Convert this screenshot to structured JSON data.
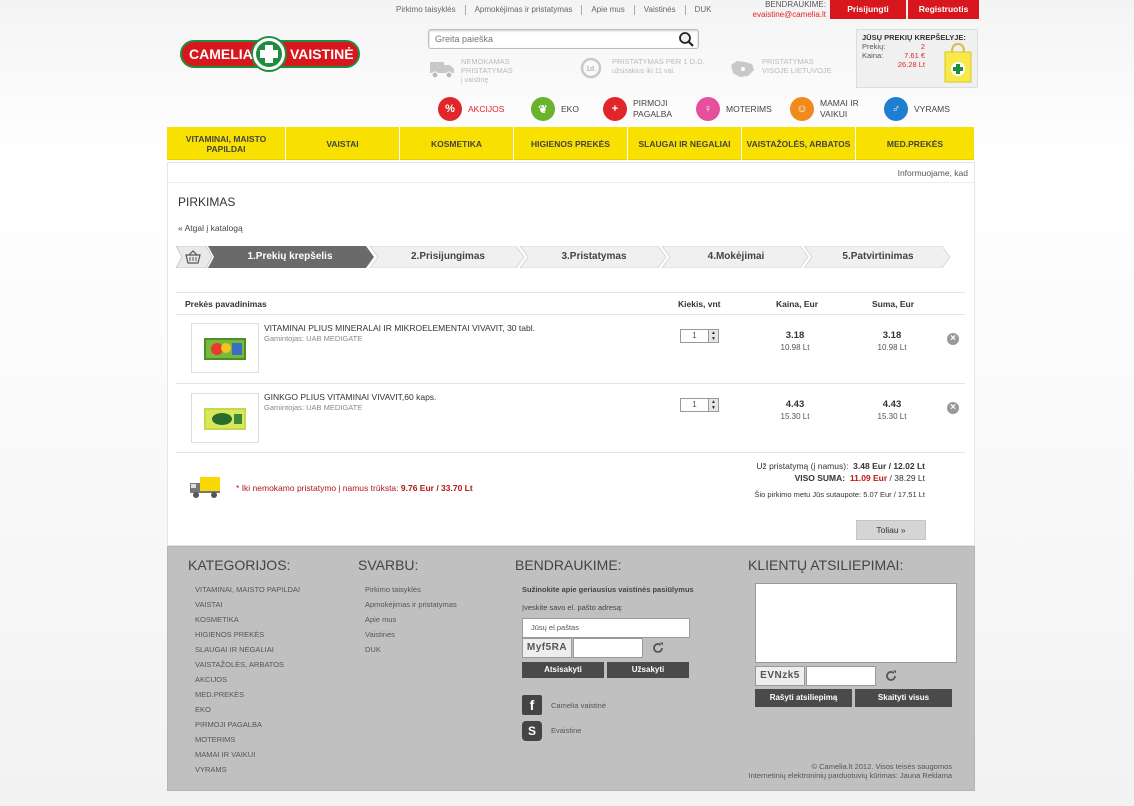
{
  "top_links": [
    "Pirkimo taisyklės",
    "Apmokėjimas ir pristatymas",
    "Apie mus",
    "Vaistinės",
    "DUK"
  ],
  "contact": {
    "label": "BENDRAUKIME:",
    "email": "evaistine@camelia.lt"
  },
  "auth": {
    "login": "Prisijungti",
    "register": "Registruotis"
  },
  "logo": {
    "left": "CAMELIA",
    "right": "VAISTINĖ"
  },
  "search": {
    "placeholder": "Greita paieška"
  },
  "features": [
    {
      "icon": "truck-icon",
      "line1": "NEMOKAMAS",
      "line2": "PRISTATYMAS",
      "line3": "į vaistinę"
    },
    {
      "icon": "clock-icon",
      "line1": "PRISTATYMAS PER 1 d.d.",
      "line2": "užsisakius iki 11 val.",
      "line3": ""
    },
    {
      "icon": "lithuania-map-icon",
      "line1": "PRISTATYMAS",
      "line2": "VISOJE LIETUVOJE",
      "line3": ""
    }
  ],
  "cart_box": {
    "title": "JŪSŲ PREKIŲ KREPŠELYJE:",
    "items_label": "Prekių:",
    "items_value": "2",
    "price_label": "Kaina:",
    "price_eur": "7.61 €",
    "price_lt": "26.28 Lt"
  },
  "category_icons": [
    {
      "label": "AKCIJOS",
      "color": "#e0262b"
    },
    {
      "label": "EKO",
      "color": "#6ab42d"
    },
    {
      "label": "PIRMOJI PAGALBA",
      "color": "#e0262b"
    },
    {
      "label": "MOTERIMS",
      "color": "#e54f9c"
    },
    {
      "label": "MAMAI IR VAIKUI",
      "color": "#f08a1c"
    },
    {
      "label": "VYRAMS",
      "color": "#1e7fd0"
    }
  ],
  "nav": [
    "VITAMINAI, MAISTO PAPILDAI",
    "VAISTAI",
    "KOSMETIKA",
    "HIGIENOS PREKĖS",
    "SLAUGAI IR NEGALIAI",
    "VAISTAŽOLĖS, ARBATOS",
    "MED.PREKĖS"
  ],
  "info_text": "Informuojame, kad",
  "page_title": "PIRKIMAS",
  "back_link": "« Atgal į katalogą",
  "steps": [
    "1.Prekių krepšelis",
    "2.Prisijungimas",
    "3.Pristatymas",
    "4.Mokėjimai",
    "5.Patvirtinimas"
  ],
  "table_headers": {
    "name": "Prekės pavadinimas",
    "qty": "Kiekis, vnt",
    "price": "Kaina, Eur",
    "sum": "Suma, Eur"
  },
  "items": [
    {
      "name": "VITAMINAI PLIUS MINERALAI IR MIKROELEMENTAI VIVAVIT, 30 tabl.",
      "maker": "Gamintojas: UAB MEDIGATE",
      "qty": "1",
      "price_eur": "3.18",
      "price_lt": "10.98 Lt",
      "sum_eur": "3.18",
      "sum_lt": "10.98 Lt"
    },
    {
      "name": "GINKGO PLIUS VITAMINAI VIVAVIT,60 kaps.",
      "maker": "Gamintojas: UAB MEDIGATE",
      "qty": "1",
      "price_eur": "4.43",
      "price_lt": "15.30 Lt",
      "sum_eur": "4.43",
      "sum_lt": "15.30 Lt"
    }
  ],
  "delivery_note": {
    "star": "*",
    "text": "Iki nemokamo pristatymo į namus trūksta: ",
    "value": "9.76 Eur / 33.70 Lt"
  },
  "totals": {
    "delivery_label": "Už pristatymą (į namus):",
    "delivery_value": "3.48 Eur / 12.02 Lt",
    "total_label": "VISO SUMA:",
    "total_eur": "11.09 Eur",
    "total_lt": " / 38.29 Lt",
    "saved_label": "Šio pirkimo metu Jūs sutaupote:",
    "saved_value": "5.07 Eur / 17.51 Lt"
  },
  "next_button": "Toliau »",
  "footer": {
    "categories_title": "KATEGORIJOS:",
    "categories": [
      "VITAMINAI, MAISTO PAPILDAI",
      "VAISTAI",
      "KOSMETIKA",
      "HIGIENOS PREKĖS",
      "SLAUGAI IR NEGALIAI",
      "VAISTAŽOLĖS, ARBATOS",
      "AKCIJOS",
      "MED.PREKĖS",
      "EKO",
      "PIRMOJI PAGALBA",
      "MOTERIMS",
      "MAMAI IR VAIKUI",
      "VYRAMS"
    ],
    "important_title": "SVARBU:",
    "important": [
      "Pirkimo taisyklės",
      "Apmokėjimas ir pristatymas",
      "Apie mus",
      "Vaistinės",
      "DUK"
    ],
    "contact_title": "BENDRAUKIME:",
    "newsletter_intro": "Sužinokite apie geriausius vaistinės pasiūlymus",
    "newsletter_label": "Įveskite savo el. pašto adresą:",
    "email_placeholder": "Jūsų el.paštas",
    "captcha1": "Myf5RA",
    "unsubscribe": "Atsisakyti",
    "subscribe": "Užsakyti",
    "facebook": "Camelia vaistinė",
    "skype": "Evaistine",
    "feedback_title": "KLIENTŲ ATSILIEPIMAI:",
    "captcha2": "EVNzk5",
    "write_feedback": "Rašyti atsiliepimą",
    "read_all": "Skaityti visus",
    "copyright": "© Camelia.lt 2012. Visos teisės saugomos",
    "credit": "Internetinių elektroninių parduotuvių kūrimas: Jauna Reklama"
  }
}
